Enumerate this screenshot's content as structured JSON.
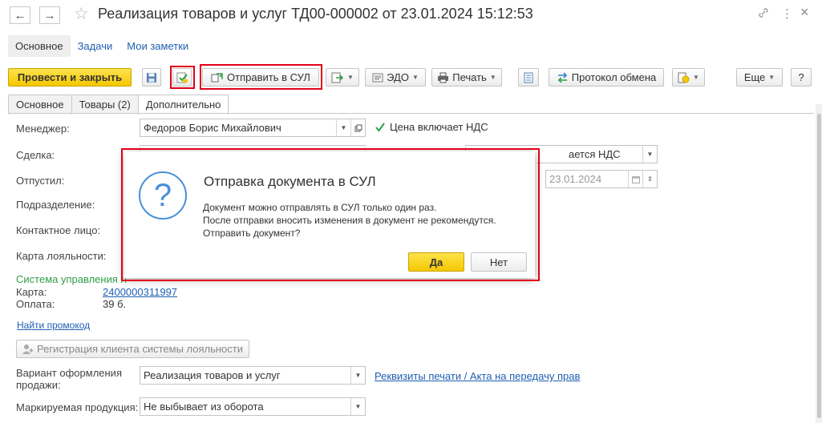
{
  "window": {
    "title": "Реализация товаров и услуг ТД00-000002 от 23.01.2024 15:12:53",
    "back_icon": "←",
    "forward_icon": "→",
    "star_icon": "☆",
    "link_icon": "🔗",
    "more_icon": "⋮",
    "close_icon": "×"
  },
  "topnav": {
    "items": [
      "Основное",
      "Задачи",
      "Мои заметки"
    ]
  },
  "toolbar": {
    "post_close": "Провести и закрыть",
    "send_sul": "Отправить в СУЛ",
    "edo": "ЭДО",
    "print": "Печать",
    "exchange_protocol": "Протокол обмена",
    "more": "Еще",
    "help": "?",
    "accent_color": "#f5c800",
    "highlight_color": "#e2001a"
  },
  "tabs": [
    "Основное",
    "Товары (2)",
    "Дополнительно"
  ],
  "form": {
    "manager_label": "Менеджер:",
    "manager_value": "Федоров Борис Михайлович",
    "price_incl_vat": "Цена включает НДС",
    "deal_label": "Сделка:",
    "vat_value": "ается НДС",
    "released_label": "Отпустил:",
    "date_value": "23.01.2024",
    "department_label": "Подразделение:",
    "contact_label": "Контактное лицо:",
    "loyalty_card_label": "Карта лояльности:",
    "loyalty_system": "Система управления л",
    "card_label": "Карта:",
    "card_value": "2400000311997",
    "payment_label": "Оплата:",
    "payment_value": "39 б.",
    "find_promo": "Найти промокод",
    "register_client": "Регистрация клиента системы лояльности",
    "variant_label_1": "Вариант оформления",
    "variant_label_2": "продажи:",
    "variant_value": "Реализация товаров и услуг",
    "print_details": "Реквизиты печати / Акта на передачу прав",
    "marked_label": "Маркируемая продукция:",
    "marked_value": "Не выбывает из оборота"
  },
  "dialog": {
    "title": "Отправка документа в СУЛ",
    "line1": "Документ можно отправлять в СУЛ только один раз.",
    "line2": "После отправки вносить изменения в документ не рекомендутся.",
    "line3": "Отправить документ?",
    "yes": "Да",
    "no": "Нет",
    "icon": "?"
  }
}
